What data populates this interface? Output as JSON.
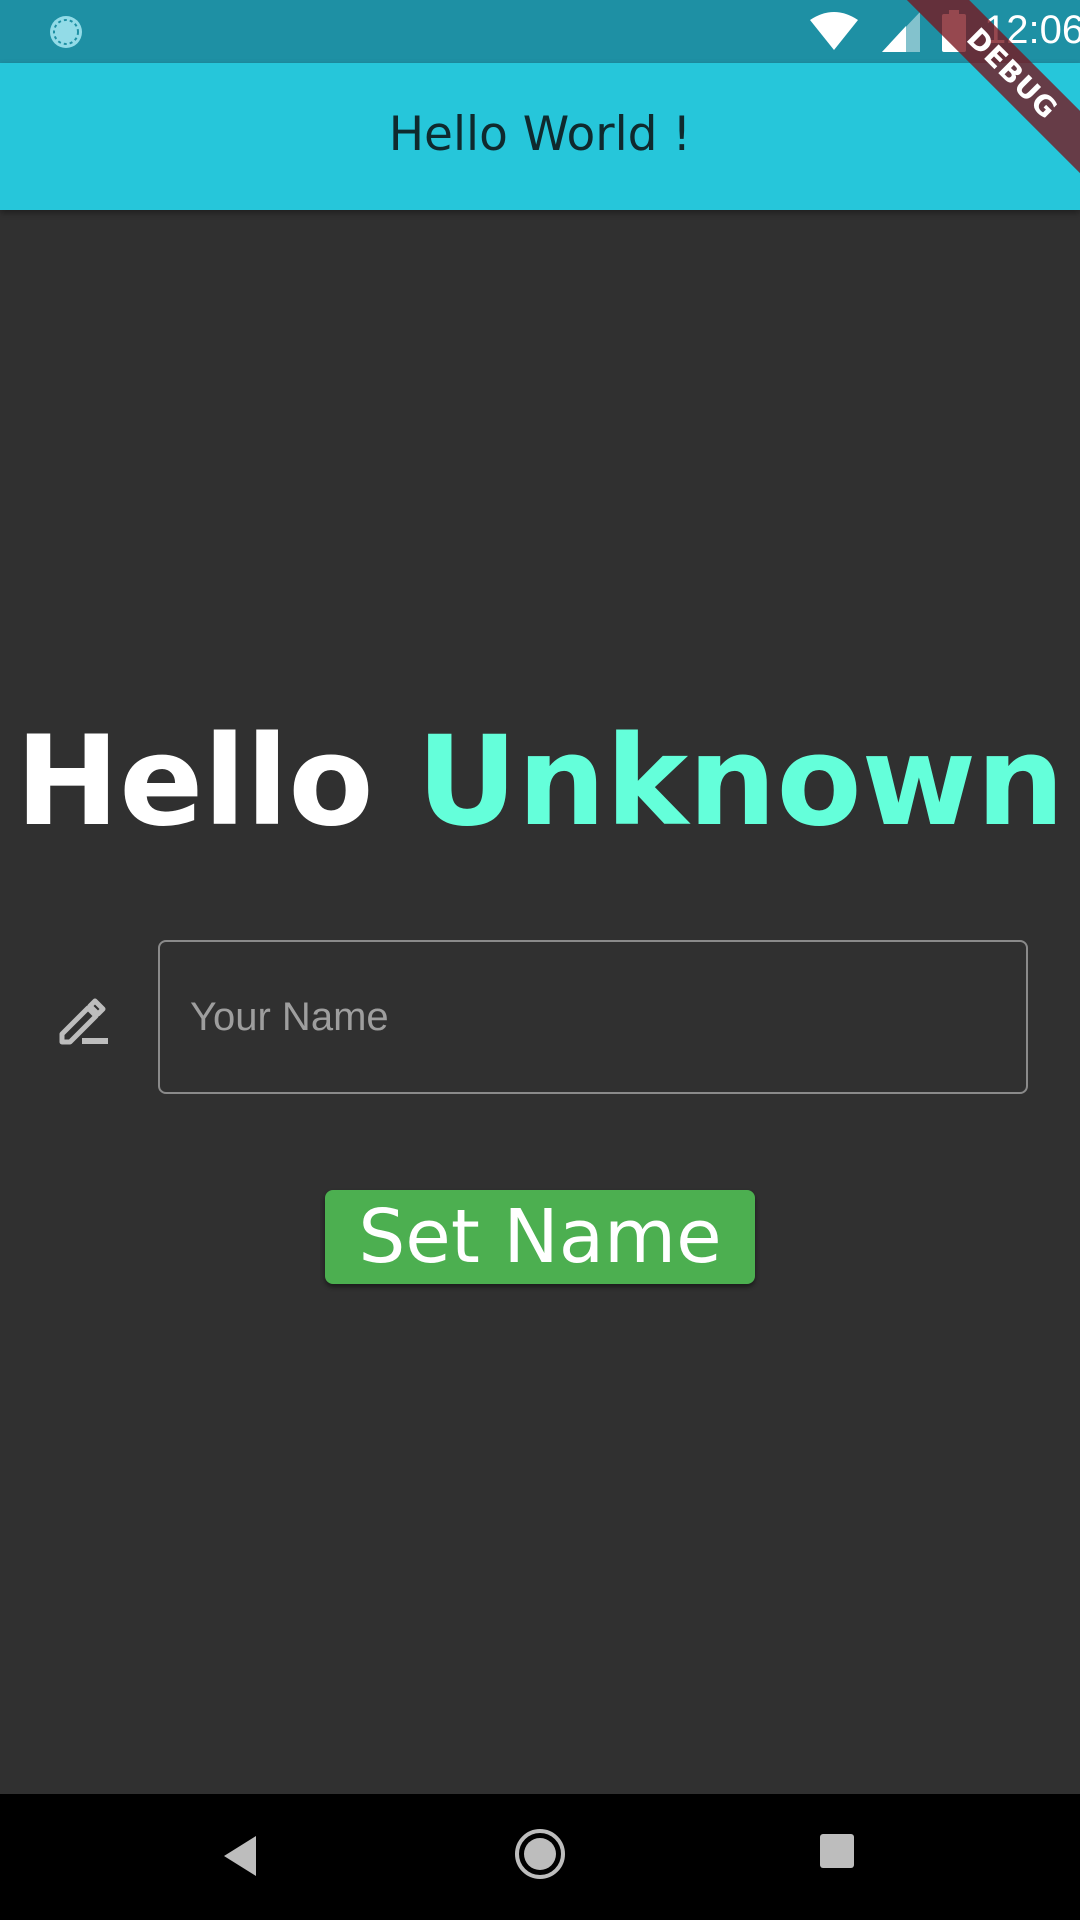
{
  "status_bar": {
    "time": "12:06",
    "left_icon": "loading-circle-icon",
    "icons": [
      "wifi-icon",
      "signal-icon",
      "battery-icon"
    ]
  },
  "app_bar": {
    "title": "Hello World !"
  },
  "debug_banner": {
    "label": "DEBUG"
  },
  "greeting": {
    "hello": "Hello",
    "name": "Unknown"
  },
  "name_field": {
    "icon": "pencil-icon",
    "placeholder": "Your Name",
    "value": ""
  },
  "set_name_button": {
    "label": "Set Name"
  },
  "nav_bar": {
    "icons": [
      "back-icon",
      "home-icon",
      "recents-icon"
    ]
  },
  "colors": {
    "background": "#303030",
    "status_bar": "#1e90a4",
    "app_bar": "#26c6da",
    "greeting_accent": "#64ffda",
    "button": "#4caf50",
    "nav_bar": "#000000"
  }
}
